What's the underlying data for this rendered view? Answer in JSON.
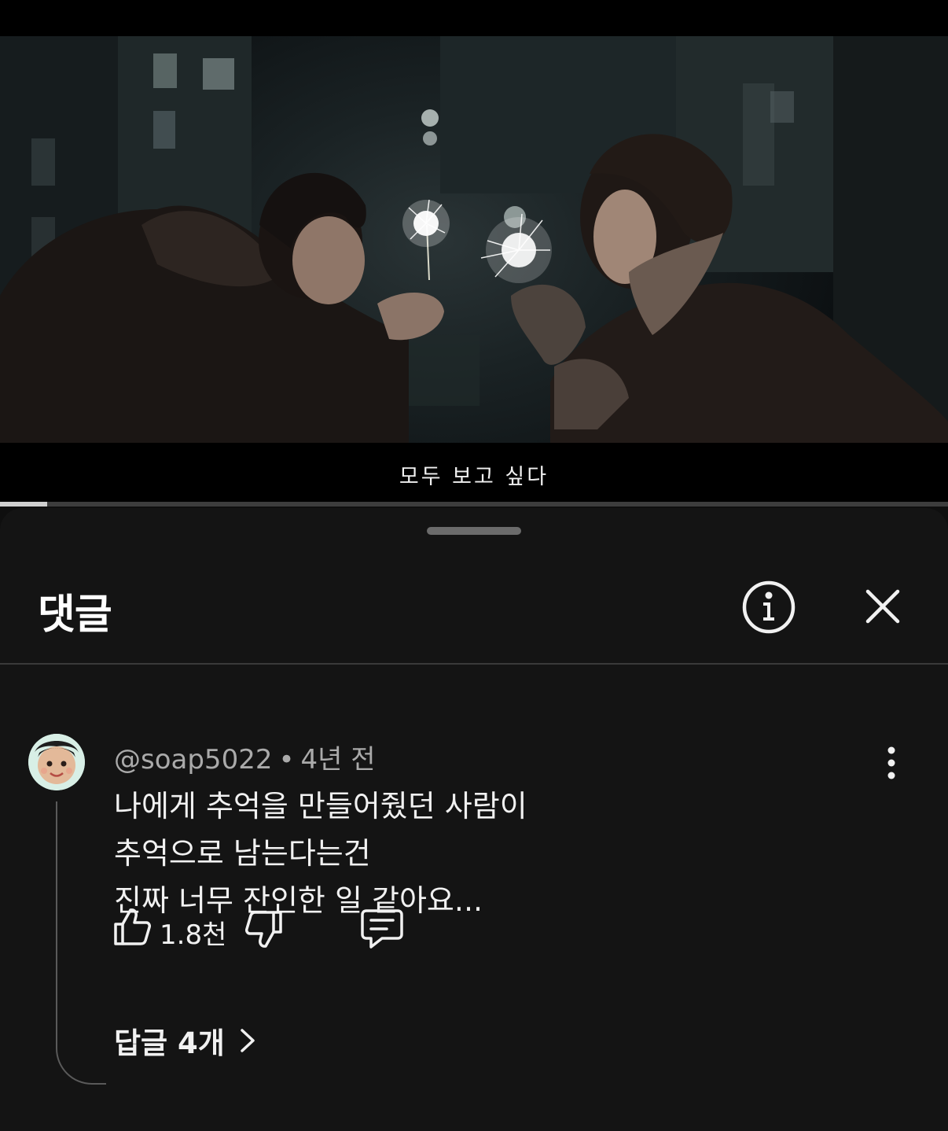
{
  "video": {
    "subtitle": "모두 보고 싶다",
    "progress_fraction": 0.05
  },
  "comments_panel": {
    "title": "댓글",
    "info_icon": "info-circle-icon",
    "close_icon": "close-icon"
  },
  "comment": {
    "author": "@soap5022",
    "separator": "•",
    "time": "4년 전",
    "lines": [
      "나에게 추억을 만들어줬던 사람이",
      "추억으로 남는다는건",
      "진짜 너무 잔인한 일 같아요..."
    ],
    "like_count": "1.8천",
    "replies_label": "답글 4개",
    "icons": {
      "like": "thumbs-up-icon",
      "dislike": "thumbs-down-icon",
      "reply": "comment-icon",
      "more": "more-vert-icon",
      "replies_chevron": "chevron-right-icon"
    }
  }
}
